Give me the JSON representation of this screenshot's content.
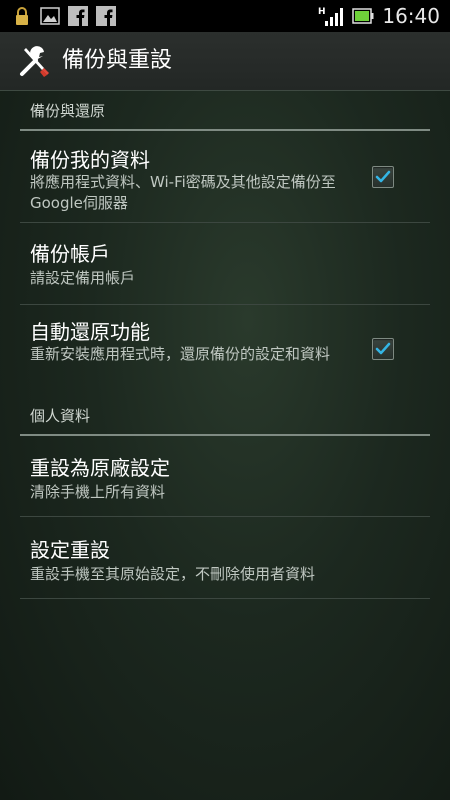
{
  "status_bar": {
    "time": "16:40",
    "left_icons": [
      "lock-icon",
      "image-icon",
      "facebook-icon",
      "facebook-icon"
    ],
    "right_icons": [
      "hspa-signal-icon",
      "battery-icon"
    ],
    "network_label": "H"
  },
  "action_bar": {
    "title": "備份與重設",
    "icon": "wrench-screwdriver-icon"
  },
  "sections": [
    {
      "header": "備份與還原",
      "items": [
        {
          "title": "備份我的資料",
          "summary": "將應用程式資料、Wi-Fi密碼及其他設定備份至Google伺服器",
          "checked": true
        },
        {
          "title": "備份帳戶",
          "summary": "請設定備用帳戶"
        },
        {
          "title": "自動還原功能",
          "summary": "重新安裝應用程式時，還原備份的設定和資料",
          "checked": true
        }
      ]
    },
    {
      "header": "個人資料",
      "items": [
        {
          "title": "重設為原廠設定",
          "summary": "清除手機上所有資料"
        },
        {
          "title": "設定重設",
          "summary": "重設手機至其原始設定，不刪除使用者資料"
        }
      ]
    }
  ],
  "colors": {
    "accent_check": "#33b5e5",
    "background": "#1c281f",
    "divider": "#3c4740"
  }
}
